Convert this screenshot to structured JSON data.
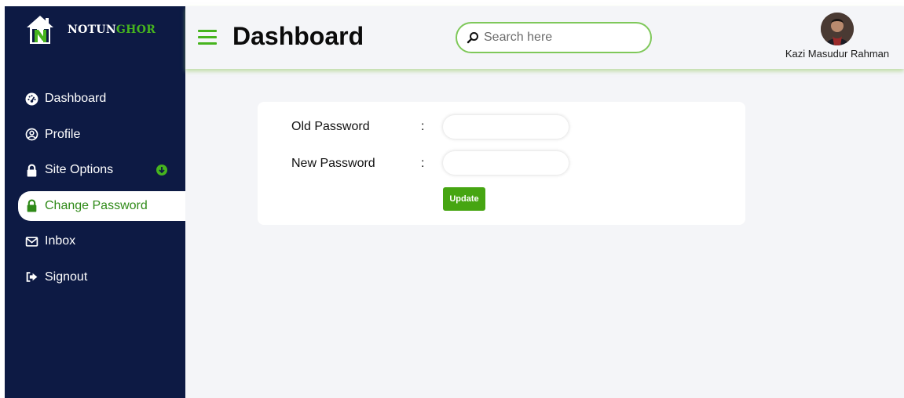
{
  "brand": {
    "name_part1": "NOTUN",
    "name_part2": "GHOR"
  },
  "colors": {
    "sidebar": "#0d1a44",
    "accent": "#46b41e",
    "active_text": "#2f8a18",
    "page_bg": "#f4f5f8"
  },
  "sidebar": {
    "items": [
      {
        "label": "Dashboard",
        "icon": "speedometer-icon"
      },
      {
        "label": "Profile",
        "icon": "user-circle-icon"
      },
      {
        "label": "Site Options",
        "icon": "lock-icon",
        "badge_icon": "arrow-down-circle-icon"
      },
      {
        "label": "Change Password",
        "icon": "lock-icon",
        "active": true
      },
      {
        "label": "Inbox",
        "icon": "envelope-icon"
      },
      {
        "label": "Signout",
        "icon": "sign-out-icon"
      }
    ]
  },
  "header": {
    "title": "Dashboard",
    "menu_icon": "hamburger-icon",
    "search": {
      "placeholder": "Search here",
      "value": ""
    },
    "user": {
      "name": "Kazi Masudur Rahman"
    }
  },
  "form": {
    "old_password": {
      "label": "Old Password",
      "separator": ":",
      "value": ""
    },
    "new_password": {
      "label": "New Password",
      "separator": ":",
      "value": ""
    },
    "submit_label": "Update"
  }
}
